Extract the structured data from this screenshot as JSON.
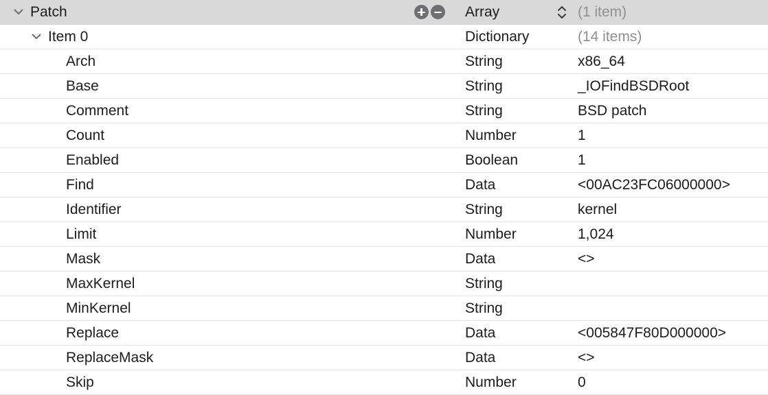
{
  "patch": {
    "key": "Patch",
    "type": "Array",
    "value": "(1 item)"
  },
  "item0": {
    "key": "Item 0",
    "type": "Dictionary",
    "value": "(14 items)"
  },
  "fields": [
    {
      "key": "Arch",
      "type": "String",
      "value": "x86_64"
    },
    {
      "key": "Base",
      "type": "String",
      "value": "_IOFindBSDRoot"
    },
    {
      "key": "Comment",
      "type": "String",
      "value": "BSD patch"
    },
    {
      "key": "Count",
      "type": "Number",
      "value": "1"
    },
    {
      "key": "Enabled",
      "type": "Boolean",
      "value": "1"
    },
    {
      "key": "Find",
      "type": "Data",
      "value": "<00AC23FC06000000>"
    },
    {
      "key": "Identifier",
      "type": "String",
      "value": "kernel"
    },
    {
      "key": "Limit",
      "type": "Number",
      "value": "1,024"
    },
    {
      "key": "Mask",
      "type": "Data",
      "value": "<>"
    },
    {
      "key": "MaxKernel",
      "type": "String",
      "value": ""
    },
    {
      "key": "MinKernel",
      "type": "String",
      "value": ""
    },
    {
      "key": "Replace",
      "type": "Data",
      "value": "<005847F80D000000>"
    },
    {
      "key": "ReplaceMask",
      "type": "Data",
      "value": "<>"
    },
    {
      "key": "Skip",
      "type": "Number",
      "value": "0"
    }
  ],
  "icons": {
    "expand": "chevron-down-icon",
    "add": "plus-circle-icon",
    "remove": "minus-circle-icon",
    "stepper": "up-down-chevron-icon"
  },
  "colors": {
    "selected_row": "#d9d9d9",
    "muted_text": "#8e8e93",
    "text": "#1c1c1e"
  }
}
